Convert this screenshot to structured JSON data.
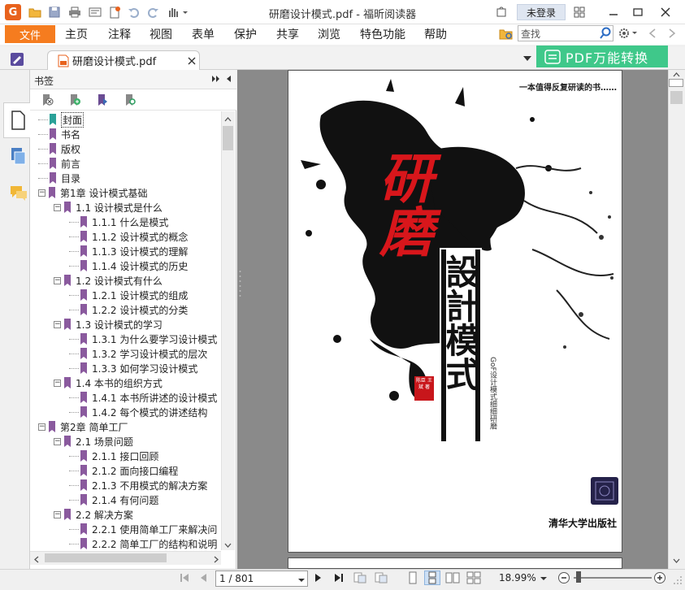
{
  "window": {
    "title": "研磨设计模式.pdf - 福昕阅读器",
    "login_label": "未登录"
  },
  "menu": {
    "file": "文件",
    "items": [
      "主页",
      "注释",
      "视图",
      "表单",
      "保护",
      "共享",
      "浏览",
      "特色功能",
      "帮助"
    ],
    "search_placeholder": "查找"
  },
  "tab": {
    "label": "研磨设计模式.pdf",
    "convert_label": "PDF万能转换"
  },
  "bookmarks": {
    "title": "书签",
    "items": [
      {
        "label": "封面",
        "level": 0,
        "expander": "",
        "selected": true
      },
      {
        "label": "书名",
        "level": 0,
        "expander": ""
      },
      {
        "label": "版权",
        "level": 0,
        "expander": ""
      },
      {
        "label": "前言",
        "level": 0,
        "expander": ""
      },
      {
        "label": "目录",
        "level": 0,
        "expander": ""
      },
      {
        "label": "第1章 设计模式基础",
        "level": 0,
        "expander": "−"
      },
      {
        "label": "1.1 设计模式是什么",
        "level": 1,
        "expander": "−"
      },
      {
        "label": "1.1.1 什么是模式",
        "level": 2,
        "expander": ""
      },
      {
        "label": "1.1.2 设计模式的概念",
        "level": 2,
        "expander": ""
      },
      {
        "label": "1.1.3 设计模式的理解",
        "level": 2,
        "expander": ""
      },
      {
        "label": "1.1.4 设计模式的历史",
        "level": 2,
        "expander": ""
      },
      {
        "label": "1.2 设计模式有什么",
        "level": 1,
        "expander": "−"
      },
      {
        "label": "1.2.1 设计模式的组成",
        "level": 2,
        "expander": ""
      },
      {
        "label": "1.2.2 设计模式的分类",
        "level": 2,
        "expander": ""
      },
      {
        "label": "1.3 设计模式的学习",
        "level": 1,
        "expander": "−"
      },
      {
        "label": "1.3.1 为什么要学习设计模式",
        "level": 2,
        "expander": ""
      },
      {
        "label": "1.3.2 学习设计模式的层次",
        "level": 2,
        "expander": ""
      },
      {
        "label": "1.3.3 如何学习设计模式",
        "level": 2,
        "expander": ""
      },
      {
        "label": "1.4 本书的组织方式",
        "level": 1,
        "expander": "−"
      },
      {
        "label": "1.4.1 本书所讲述的设计模式",
        "level": 2,
        "expander": ""
      },
      {
        "label": "1.4.2 每个模式的讲述结构",
        "level": 2,
        "expander": ""
      },
      {
        "label": "第2章 简单工厂",
        "level": 0,
        "expander": "−"
      },
      {
        "label": "2.1 场景问题",
        "level": 1,
        "expander": "−"
      },
      {
        "label": "2.1.1 接口回顾",
        "level": 2,
        "expander": ""
      },
      {
        "label": "2.1.2 面向接口编程",
        "level": 2,
        "expander": ""
      },
      {
        "label": "2.1.3 不用模式的解决方案",
        "level": 2,
        "expander": ""
      },
      {
        "label": "2.1.4 有何问题",
        "level": 2,
        "expander": ""
      },
      {
        "label": "2.2 解决方案",
        "level": 1,
        "expander": "−"
      },
      {
        "label": "2.2.1 使用简单工厂来解决问",
        "level": 2,
        "expander": ""
      },
      {
        "label": "2.2.2 简单工厂的结构和说明",
        "level": 2,
        "expander": ""
      }
    ]
  },
  "cover": {
    "tagline": "一本值得反复研读的书……",
    "big_red": "研磨",
    "big_black": "設計模式",
    "side_text": "GoF设计模式细细研磨",
    "seal_text": "陈臣 王斌 著",
    "publisher": "清华大学出版社"
  },
  "status": {
    "page_value": "1 / 801",
    "zoom": "18.99%"
  },
  "colors": {
    "accent_orange": "#f57c1f",
    "convert_green": "#3fc88a",
    "bookmark_purple": "#8a5a9e",
    "bookmark_teal": "#2aa198",
    "cover_red": "#d8161b"
  }
}
